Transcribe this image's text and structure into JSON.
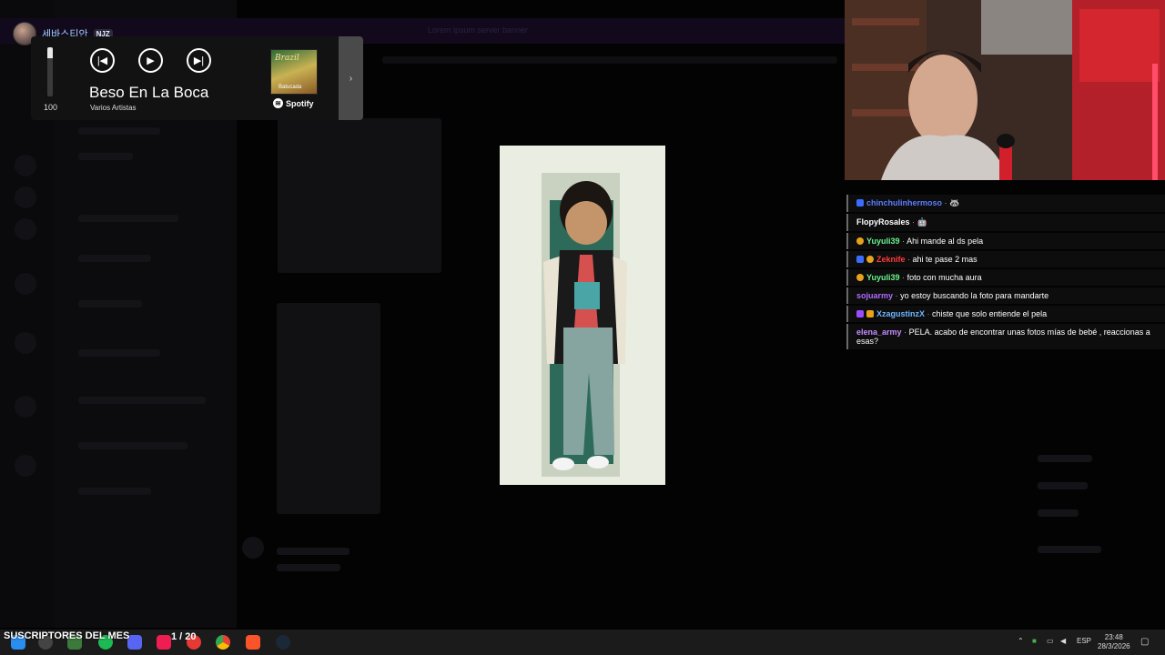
{
  "streamer": {
    "name": "세바스티안",
    "badge": "NJZ"
  },
  "background": {
    "banner_text": "Lorem ipsum server banner"
  },
  "music_player": {
    "volume": 100,
    "volume_label": "100",
    "song_title": "Beso En La Boca",
    "artist": "Varios Artistas",
    "album_title": "Brazil",
    "album_subtitle": "Batucada",
    "service": "Spotify",
    "next_label": "›"
  },
  "chat": {
    "messages": [
      {
        "user": "chinchulinhermoso",
        "text": "",
        "color": "#5b7cff"
      },
      {
        "user": "FlopyRosales",
        "text": "",
        "color": "#ffffff"
      },
      {
        "user": "Yuyuli39",
        "text": "Ahi mande al ds pela",
        "color": "#6cf38c"
      },
      {
        "user": "Zeknife",
        "text": "ahi te pase 2 mas",
        "color": "#ff3b3b"
      },
      {
        "user": "Yuyuli39",
        "text": "foto con mucha aura",
        "color": "#6cf38c"
      },
      {
        "user": "sojuarmy",
        "text": "yo estoy buscando la foto para mandarte",
        "color": "#b06cff"
      },
      {
        "user": "XzagustinzX",
        "text": "chiste que solo entiende el pela",
        "color": "#6db6ff"
      },
      {
        "user": "elena_army",
        "text": "PELA. acabo de encontrar unas fotos mías de bebé , reaccionas a esas?",
        "color": "#c58cff"
      }
    ]
  },
  "taskbar": {
    "overlay_label": "SUSCRIPTORES DEL MES",
    "overlay_count": "1 / 20",
    "language": "ESP",
    "time": "23:48",
    "date": "28/3/2026"
  }
}
